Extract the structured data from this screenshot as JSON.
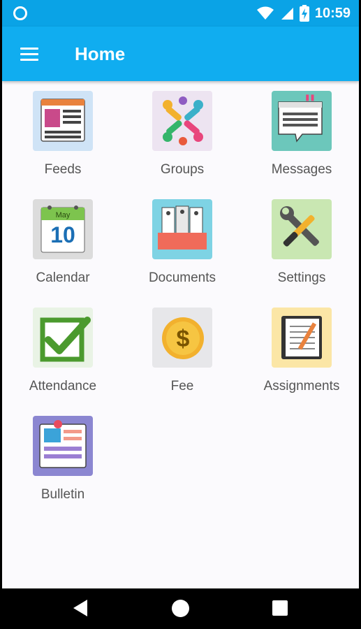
{
  "status_bar": {
    "time": "10:59",
    "icons": [
      "sync-circle-icon",
      "wifi-icon",
      "cell-signal-icon",
      "battery-charging-icon"
    ]
  },
  "app_bar": {
    "menu_icon": "hamburger-menu-icon",
    "title": "Home"
  },
  "tiles": [
    {
      "label": "Feeds",
      "icon": "feeds-icon"
    },
    {
      "label": "Groups",
      "icon": "groups-icon"
    },
    {
      "label": "Messages",
      "icon": "messages-icon"
    },
    {
      "label": "Calendar",
      "icon": "calendar-icon",
      "calendar_month": "May",
      "calendar_day": "10"
    },
    {
      "label": "Documents",
      "icon": "documents-icon"
    },
    {
      "label": "Settings",
      "icon": "settings-icon"
    },
    {
      "label": "Attendance",
      "icon": "attendance-icon"
    },
    {
      "label": "Fee",
      "icon": "fee-icon",
      "symbol": "$"
    },
    {
      "label": "Assignments",
      "icon": "assignments-icon"
    },
    {
      "label": "Bulletin",
      "icon": "bulletin-icon"
    }
  ],
  "nav_bar": {
    "icons": [
      "back-icon",
      "home-icon",
      "recent-apps-icon"
    ]
  },
  "colors": {
    "status_bar": "#0aa3e6",
    "app_bar": "#10adf0",
    "background": "#fbfafd"
  }
}
